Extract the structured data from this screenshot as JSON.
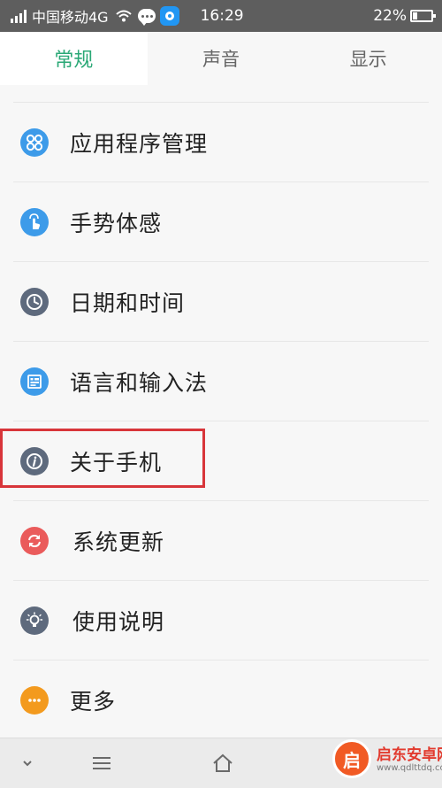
{
  "status_bar": {
    "carrier": "中国移动4G",
    "time": "16:29",
    "battery": "22%",
    "icons": [
      "signal-icon",
      "wifi-icon",
      "message-icon",
      "app-notification-icon",
      "battery-icon"
    ]
  },
  "tabs": [
    {
      "label": "常规",
      "active": true
    },
    {
      "label": "声音",
      "active": false
    },
    {
      "label": "显示",
      "active": false
    }
  ],
  "settings_items": [
    {
      "label": "应用程序管理",
      "icon": "apps-icon",
      "color": "#3d9be9"
    },
    {
      "label": "手势体感",
      "icon": "gesture-icon",
      "color": "#3d9be9"
    },
    {
      "label": "日期和时间",
      "icon": "clock-icon",
      "color": "#5e6a7d"
    },
    {
      "label": "语言和输入法",
      "icon": "keyboard-icon",
      "color": "#3d9be9"
    },
    {
      "label": "关于手机",
      "icon": "info-icon",
      "color": "#5e6a7d"
    },
    {
      "label": "系统更新",
      "icon": "update-icon",
      "color": "#ea5b5b"
    },
    {
      "label": "使用说明",
      "icon": "lightbulb-icon",
      "color": "#5e6a7d"
    },
    {
      "label": "更多",
      "icon": "more-icon",
      "color": "#f39a1e"
    }
  ],
  "highlighted_item": "关于手机",
  "nav_bar": {
    "icons": [
      "chevron-down-icon",
      "menu-icon",
      "home-icon"
    ]
  },
  "watermark": {
    "title": "启东安卓网",
    "url": "www.qdlttdq.com",
    "logo_text": "启"
  },
  "colors": {
    "accent": "#2aa876",
    "status_bar": "#5e5e5e",
    "highlight_border": "#d8353a"
  }
}
